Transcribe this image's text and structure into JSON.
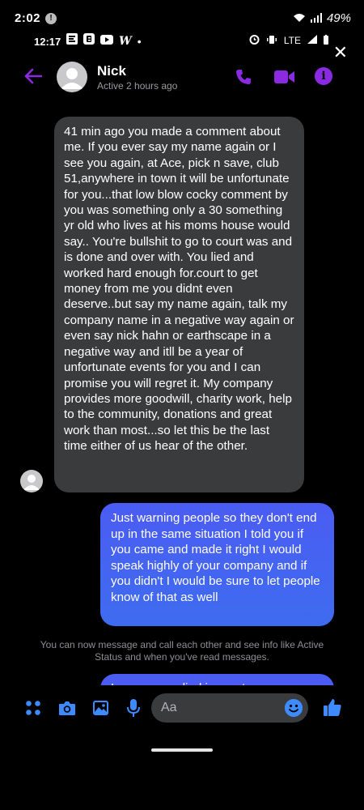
{
  "outer_status": {
    "time": "2:02",
    "notification_badge": "!",
    "battery": "49%"
  },
  "inner_status": {
    "time": "12:17",
    "icons": [
      "e-icon",
      "b-icon",
      "youtube-icon",
      "w-icon",
      "dot"
    ],
    "right_icons": [
      "alarm-icon",
      "vibrate-icon",
      "lte-signal-icon",
      "battery-icon"
    ],
    "lte_label": "LTE",
    "w_glyph": "W",
    "dot_glyph": "•"
  },
  "header": {
    "name": "Nick",
    "status": "Active 2 hours ago",
    "accent_color": "#8a2be2"
  },
  "messages": {
    "incoming": "41 min ago you made a comment about me.  If you ever say my name again or I see you again, at Ace, pick n save, club 51,anywhere in town it will be unfortunate for you...that low blow cocky comment by you was something only a 30 something  yr old who lives at his moms house would say.. You're bullshit to go to court was and is done and over with.  You lied and worked hard enough for.court to get money from me you didnt even deserve..but say my name again, talk my company name in a negative  way again or even say nick hahn or earthscape in a negative  way and itll be a year of unfortunate events for you and I can promise you will regret it.  My company provides more goodwill, charity work, help to the community, donations and great work than most...so let this be the last time either of us hear of the other.",
    "outgoing": "Just warning people so they don't end up in the same situation I told you if you came and made it right I would speak highly of your company and if you didn't I would be sure to let people know of that as well",
    "notice": "You can now message and call each other and see info like Active Status and when you've read messages.",
    "partial_outgoing": "I never speedied in court you were"
  },
  "composer": {
    "placeholder": "Aa"
  },
  "colors": {
    "incoming_bubble": "#3a3b3c",
    "outgoing_bubble": "#4b5cf2",
    "icon_blue": "#3d8bff"
  }
}
